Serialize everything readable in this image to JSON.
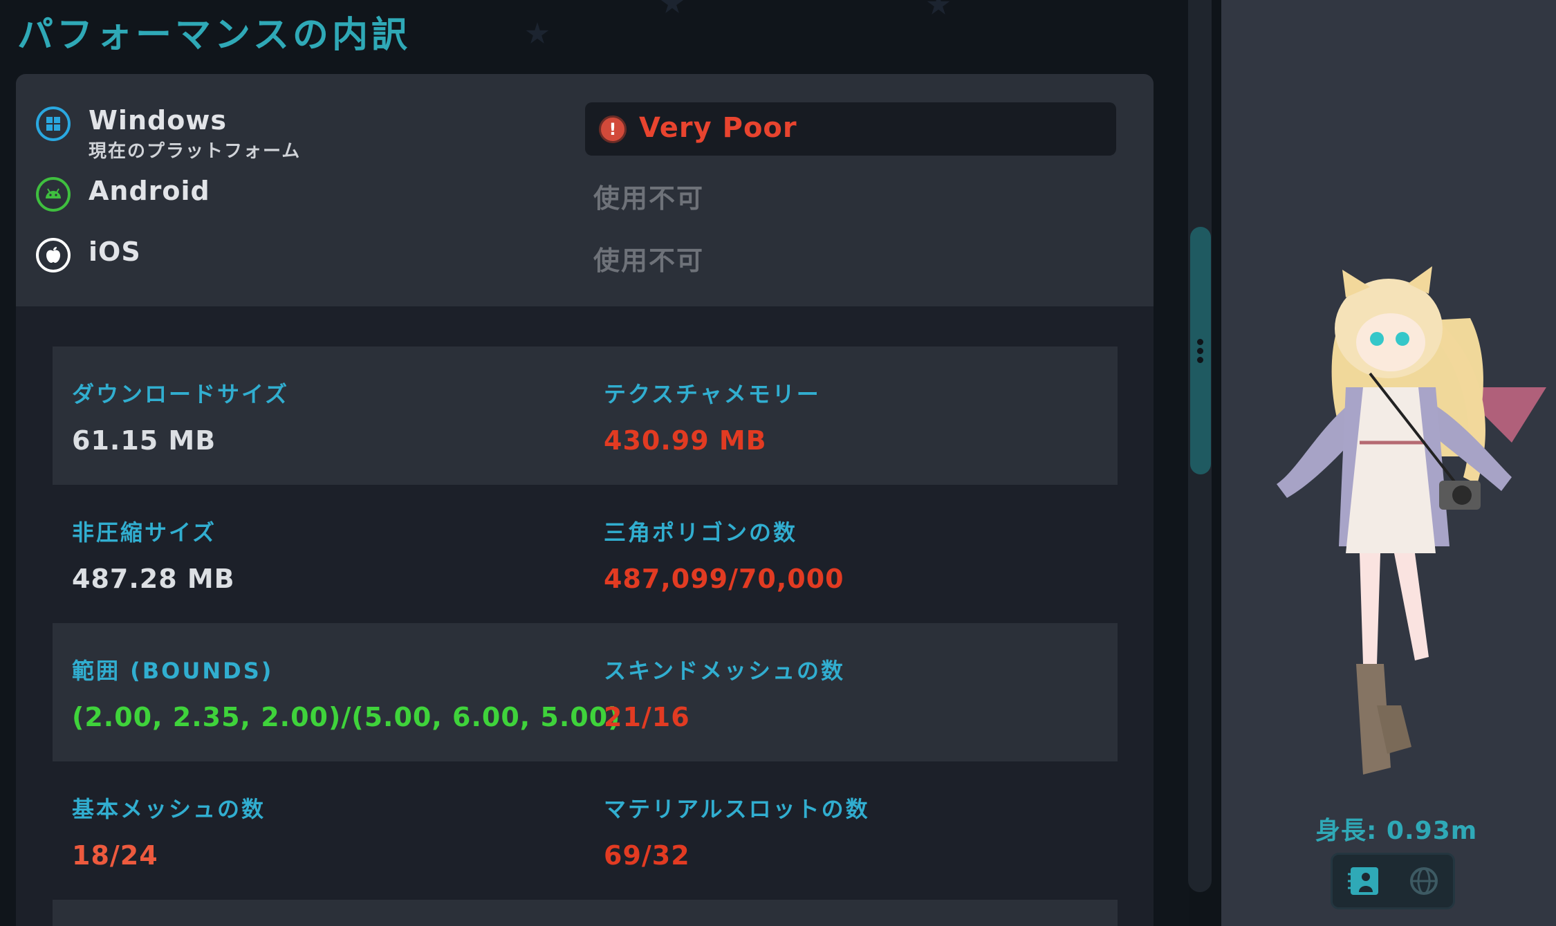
{
  "page_title": "パフォーマンスの内訳",
  "platforms": [
    {
      "name": "Windows",
      "sub": "現在のプラットフォーム",
      "status": "Very Poor",
      "icon": "windows-icon",
      "color": "#2aa8e0"
    },
    {
      "name": "Android",
      "status": "使用不可",
      "icon": "android-icon",
      "color": "#3fbf3f"
    },
    {
      "name": "iOS",
      "status": "使用不可",
      "icon": "apple-icon",
      "color": "#ffffff"
    }
  ],
  "stats": [
    {
      "label": "ダウンロードサイズ",
      "value": "61.15 MB"
    },
    {
      "label": "テクスチャメモリー",
      "value": "430.99 MB"
    },
    {
      "label": "非圧縮サイズ",
      "value": "487.28 MB"
    },
    {
      "label": "三角ポリゴンの数",
      "value": "487,099/70,000"
    },
    {
      "label": "範囲 (BOUNDS)",
      "value": "(2.00, 2.35, 2.00)/(5.00, 6.00, 5.00)"
    },
    {
      "label": "スキンドメッシュの数",
      "value": "21/16"
    },
    {
      "label": "基本メッシュの数",
      "value": "18/24"
    },
    {
      "label": "マテリアルスロットの数",
      "value": "69/32"
    }
  ],
  "avatar": {
    "height_label": "身長: 0.93m"
  },
  "colors": {
    "accent": "#2fa9b7",
    "label": "#31aed0",
    "bad": "#e23b22",
    "good": "#3fd33b",
    "warn": "#ed5a3e"
  }
}
